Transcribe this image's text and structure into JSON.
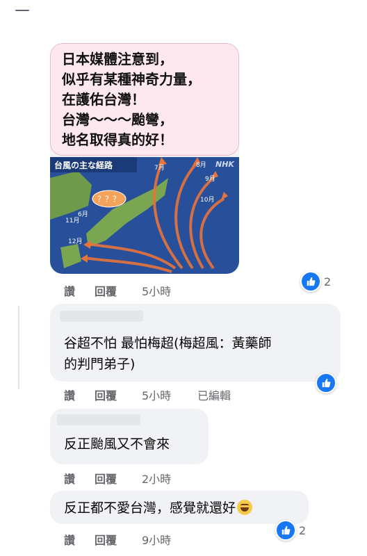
{
  "comments": [
    {
      "image_text": "日本媒體注意到，\n似乎有某種神奇力量，\n在護佑台灣！\n台灣～～～颱彎，\n地名取得真的好！",
      "map": {
        "title": "台風の主な経路",
        "source": "NHK",
        "question": "？？？",
        "months": [
          "6月",
          "7月",
          "8月",
          "9月",
          "10月",
          "11月",
          "12月"
        ]
      },
      "like_label": "讚",
      "reply_label": "回覆",
      "time": "5小時",
      "reaction_count": "2"
    },
    {
      "text": "谷超不怕  最怕梅超(梅超風：黃藥師\n的判門弟子)",
      "like_label": "讚",
      "reply_label": "回覆",
      "time": "5小時",
      "edited": "已編輯"
    },
    {
      "text": "反正颱風又不會來",
      "like_label": "讚",
      "reply_label": "回覆",
      "time": "2小時"
    },
    {
      "text": "反正都不愛台灣，感覺就還好",
      "like_label": "讚",
      "reply_label": "回覆",
      "time": "9小時",
      "reaction_count": "2"
    }
  ],
  "colors": {
    "like_blue": "#1877f2",
    "bubble_bg": "#f0f2f5",
    "meta_gray": "#65676b"
  },
  "icons": {
    "reaction": "thumbs-up-icon",
    "emoji": "grinning-sweat-emoji"
  }
}
